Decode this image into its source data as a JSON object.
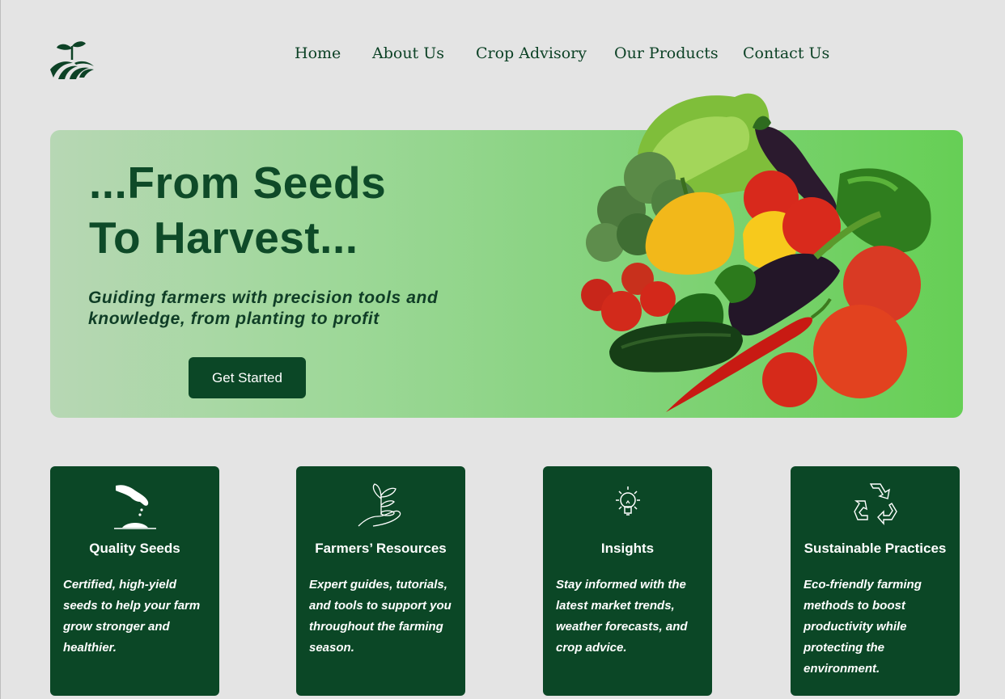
{
  "header": {
    "logo_icon": "sprout-field-icon",
    "nav": [
      {
        "label": "Home"
      },
      {
        "label": "About Us"
      },
      {
        "label": "Crop Advisory"
      },
      {
        "label": "Our Products"
      },
      {
        "label": "Contact Us"
      }
    ]
  },
  "hero": {
    "title_line1": "...From Seeds",
    "title_line2": "To Harvest...",
    "subtitle": "Guiding farmers with precision tools and knowledge, from planting to profit",
    "cta_label": "Get Started",
    "image": "vegetables-pile-image"
  },
  "cards": [
    {
      "icon": "hand-sowing-seeds-icon",
      "title": "Quality Seeds",
      "text": "Certified, high-yield seeds to help your farm grow stronger and healthier."
    },
    {
      "icon": "hand-holding-sprout-icon",
      "title": "Farmers’ Resources",
      "text": "Expert guides, tutorials, and tools to support you throughout the farming season."
    },
    {
      "icon": "lightbulb-icon",
      "title": "Insights",
      "text": "Stay informed with the latest market trends, weather forecasts, and crop advice."
    },
    {
      "icon": "recycle-icon",
      "title": "Sustainable Practices",
      "text": "Eco-friendly farming methods to boost productivity while protecting the environment."
    }
  ],
  "colors": {
    "brand_dark_green": "#0b4726",
    "page_background": "#e4e4e4",
    "hero_gradient_start": "#b7d7b4",
    "hero_gradient_end": "#66cf55"
  }
}
